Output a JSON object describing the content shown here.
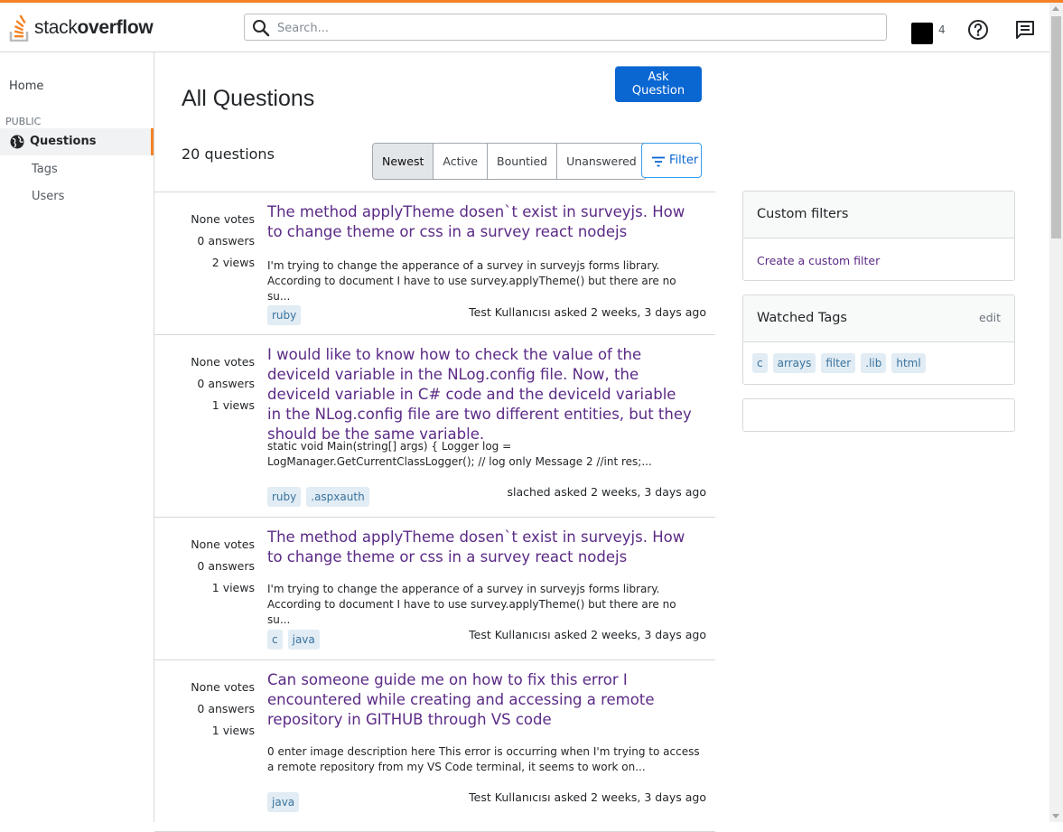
{
  "header": {
    "logo_light": "stack",
    "logo_bold": "overflow",
    "search_placeholder": "Search...",
    "reputation": "4"
  },
  "sidebar": {
    "home": "Home",
    "section": "PUBLIC",
    "questions": "Questions",
    "tags": "Tags",
    "users": "Users"
  },
  "main": {
    "title": "All Questions",
    "ask_button": "Ask Question",
    "count": "20 questions",
    "tabs": [
      "Newest",
      "Active",
      "Bountied",
      "Unanswered"
    ],
    "filter": "Filter"
  },
  "questions": [
    {
      "votes": "None votes",
      "answers": "0 answers",
      "views": "2 views",
      "title": "The method applyTheme dosen`t exist in surveyjs. How to change theme or css in a survey react nodejs",
      "excerpt": "I'm trying to change the apperance of a survey in surveyjs forms library. According to document I have to use survey.applyTheme() but there are no su...",
      "tags": [
        "ruby"
      ],
      "meta": "Test Kullanıcısı asked 2 weeks, 3 days ago"
    },
    {
      "votes": "None votes",
      "answers": "0 answers",
      "views": "1 views",
      "title": "I would like to know how to check the value of the deviceId variable in the NLog.config file. Now, the deviceId variable in C# code and the deviceId variable in the NLog.config file are two different entities, but they should be the same variable.",
      "excerpt": "static void Main(string[] args) { Logger log = LogManager.GetCurrentClassLogger(); // log only Message 2 //int res;...",
      "tags": [
        "ruby",
        ".aspxauth"
      ],
      "meta": "slached asked 2 weeks, 3 days ago"
    },
    {
      "votes": "None votes",
      "answers": "0 answers",
      "views": "1 views",
      "title": "The method applyTheme dosen`t exist in surveyjs. How to change theme or css in a survey react nodejs",
      "excerpt": "I'm trying to change the apperance of a survey in surveyjs forms library. According to document I have to use survey.applyTheme() but there are no su...",
      "tags": [
        "c",
        "java"
      ],
      "meta": "Test Kullanıcısı asked 2 weeks, 3 days ago"
    },
    {
      "votes": "None votes",
      "answers": "0 answers",
      "views": "1 views",
      "title": "Can someone guide me on how to fix this error I encountered while creating and accessing a remote repository in GITHUB through VS code",
      "excerpt": "0 enter image description here This error is occurring when I'm trying to access a remote repository from my VS Code terminal, it seems to work on...",
      "tags": [
        "java"
      ],
      "meta": "Test Kullanıcısı asked 2 weeks, 3 days ago"
    }
  ],
  "right": {
    "custom_filters_title": "Custom filters",
    "custom_filter_link": "Create a custom filter",
    "watched_title": "Watched Tags",
    "watched_edit": "edit",
    "watched_tags": [
      "c",
      "arrays",
      "filter",
      ".lib",
      "html"
    ]
  },
  "colors": {
    "accent": "#f48225",
    "primary_button": "#0a66d1",
    "title_link": "#5b2a86",
    "tag_bg": "#e1ecf4",
    "tag_text": "#39739d"
  }
}
